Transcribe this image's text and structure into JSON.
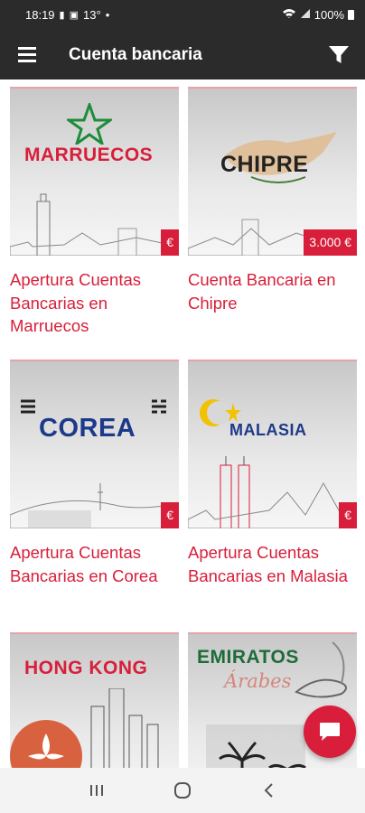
{
  "status": {
    "time": "18:19",
    "temp": "13°",
    "dot": "•",
    "battery": "100%"
  },
  "app_bar": {
    "title": "Cuenta bancaria"
  },
  "cards": [
    {
      "country_label": "MARRUECOS",
      "title": "Apertura Cuentas Bancarias en Marruecos",
      "price": "€"
    },
    {
      "country_label": "CHIPRE",
      "title": "Cuenta Bancaria en Chipre",
      "price": "3.000 €"
    },
    {
      "country_label": "COREA",
      "title": "Apertura Cuentas Bancarias en Corea",
      "price": "€"
    },
    {
      "country_label": "MALASIA",
      "title": "Apertura Cuentas Bancarias en Malasia",
      "price": "€"
    },
    {
      "country_label": "HONG KONG",
      "title": "",
      "price": ""
    },
    {
      "country_label": "EMIRATOS",
      "country_sub": "Árabes",
      "title": "",
      "price": ""
    }
  ],
  "colors": {
    "accent": "#d81e3a",
    "app_bar": "#2b2b2b"
  }
}
